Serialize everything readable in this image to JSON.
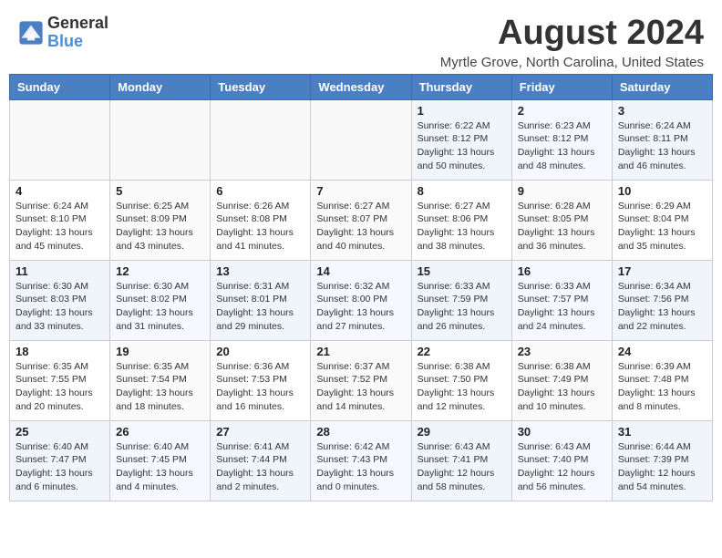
{
  "logo": {
    "line1": "General",
    "line2": "Blue"
  },
  "title": "August 2024",
  "subtitle": "Myrtle Grove, North Carolina, United States",
  "days_of_week": [
    "Sunday",
    "Monday",
    "Tuesday",
    "Wednesday",
    "Thursday",
    "Friday",
    "Saturday"
  ],
  "weeks": [
    [
      {
        "day": "",
        "info": ""
      },
      {
        "day": "",
        "info": ""
      },
      {
        "day": "",
        "info": ""
      },
      {
        "day": "",
        "info": ""
      },
      {
        "day": "1",
        "info": "Sunrise: 6:22 AM\nSunset: 8:12 PM\nDaylight: 13 hours\nand 50 minutes."
      },
      {
        "day": "2",
        "info": "Sunrise: 6:23 AM\nSunset: 8:12 PM\nDaylight: 13 hours\nand 48 minutes."
      },
      {
        "day": "3",
        "info": "Sunrise: 6:24 AM\nSunset: 8:11 PM\nDaylight: 13 hours\nand 46 minutes."
      }
    ],
    [
      {
        "day": "4",
        "info": "Sunrise: 6:24 AM\nSunset: 8:10 PM\nDaylight: 13 hours\nand 45 minutes."
      },
      {
        "day": "5",
        "info": "Sunrise: 6:25 AM\nSunset: 8:09 PM\nDaylight: 13 hours\nand 43 minutes."
      },
      {
        "day": "6",
        "info": "Sunrise: 6:26 AM\nSunset: 8:08 PM\nDaylight: 13 hours\nand 41 minutes."
      },
      {
        "day": "7",
        "info": "Sunrise: 6:27 AM\nSunset: 8:07 PM\nDaylight: 13 hours\nand 40 minutes."
      },
      {
        "day": "8",
        "info": "Sunrise: 6:27 AM\nSunset: 8:06 PM\nDaylight: 13 hours\nand 38 minutes."
      },
      {
        "day": "9",
        "info": "Sunrise: 6:28 AM\nSunset: 8:05 PM\nDaylight: 13 hours\nand 36 minutes."
      },
      {
        "day": "10",
        "info": "Sunrise: 6:29 AM\nSunset: 8:04 PM\nDaylight: 13 hours\nand 35 minutes."
      }
    ],
    [
      {
        "day": "11",
        "info": "Sunrise: 6:30 AM\nSunset: 8:03 PM\nDaylight: 13 hours\nand 33 minutes."
      },
      {
        "day": "12",
        "info": "Sunrise: 6:30 AM\nSunset: 8:02 PM\nDaylight: 13 hours\nand 31 minutes."
      },
      {
        "day": "13",
        "info": "Sunrise: 6:31 AM\nSunset: 8:01 PM\nDaylight: 13 hours\nand 29 minutes."
      },
      {
        "day": "14",
        "info": "Sunrise: 6:32 AM\nSunset: 8:00 PM\nDaylight: 13 hours\nand 27 minutes."
      },
      {
        "day": "15",
        "info": "Sunrise: 6:33 AM\nSunset: 7:59 PM\nDaylight: 13 hours\nand 26 minutes."
      },
      {
        "day": "16",
        "info": "Sunrise: 6:33 AM\nSunset: 7:57 PM\nDaylight: 13 hours\nand 24 minutes."
      },
      {
        "day": "17",
        "info": "Sunrise: 6:34 AM\nSunset: 7:56 PM\nDaylight: 13 hours\nand 22 minutes."
      }
    ],
    [
      {
        "day": "18",
        "info": "Sunrise: 6:35 AM\nSunset: 7:55 PM\nDaylight: 13 hours\nand 20 minutes."
      },
      {
        "day": "19",
        "info": "Sunrise: 6:35 AM\nSunset: 7:54 PM\nDaylight: 13 hours\nand 18 minutes."
      },
      {
        "day": "20",
        "info": "Sunrise: 6:36 AM\nSunset: 7:53 PM\nDaylight: 13 hours\nand 16 minutes."
      },
      {
        "day": "21",
        "info": "Sunrise: 6:37 AM\nSunset: 7:52 PM\nDaylight: 13 hours\nand 14 minutes."
      },
      {
        "day": "22",
        "info": "Sunrise: 6:38 AM\nSunset: 7:50 PM\nDaylight: 13 hours\nand 12 minutes."
      },
      {
        "day": "23",
        "info": "Sunrise: 6:38 AM\nSunset: 7:49 PM\nDaylight: 13 hours\nand 10 minutes."
      },
      {
        "day": "24",
        "info": "Sunrise: 6:39 AM\nSunset: 7:48 PM\nDaylight: 13 hours\nand 8 minutes."
      }
    ],
    [
      {
        "day": "25",
        "info": "Sunrise: 6:40 AM\nSunset: 7:47 PM\nDaylight: 13 hours\nand 6 minutes."
      },
      {
        "day": "26",
        "info": "Sunrise: 6:40 AM\nSunset: 7:45 PM\nDaylight: 13 hours\nand 4 minutes."
      },
      {
        "day": "27",
        "info": "Sunrise: 6:41 AM\nSunset: 7:44 PM\nDaylight: 13 hours\nand 2 minutes."
      },
      {
        "day": "28",
        "info": "Sunrise: 6:42 AM\nSunset: 7:43 PM\nDaylight: 13 hours\nand 0 minutes."
      },
      {
        "day": "29",
        "info": "Sunrise: 6:43 AM\nSunset: 7:41 PM\nDaylight: 12 hours\nand 58 minutes."
      },
      {
        "day": "30",
        "info": "Sunrise: 6:43 AM\nSunset: 7:40 PM\nDaylight: 12 hours\nand 56 minutes."
      },
      {
        "day": "31",
        "info": "Sunrise: 6:44 AM\nSunset: 7:39 PM\nDaylight: 12 hours\nand 54 minutes."
      }
    ]
  ]
}
